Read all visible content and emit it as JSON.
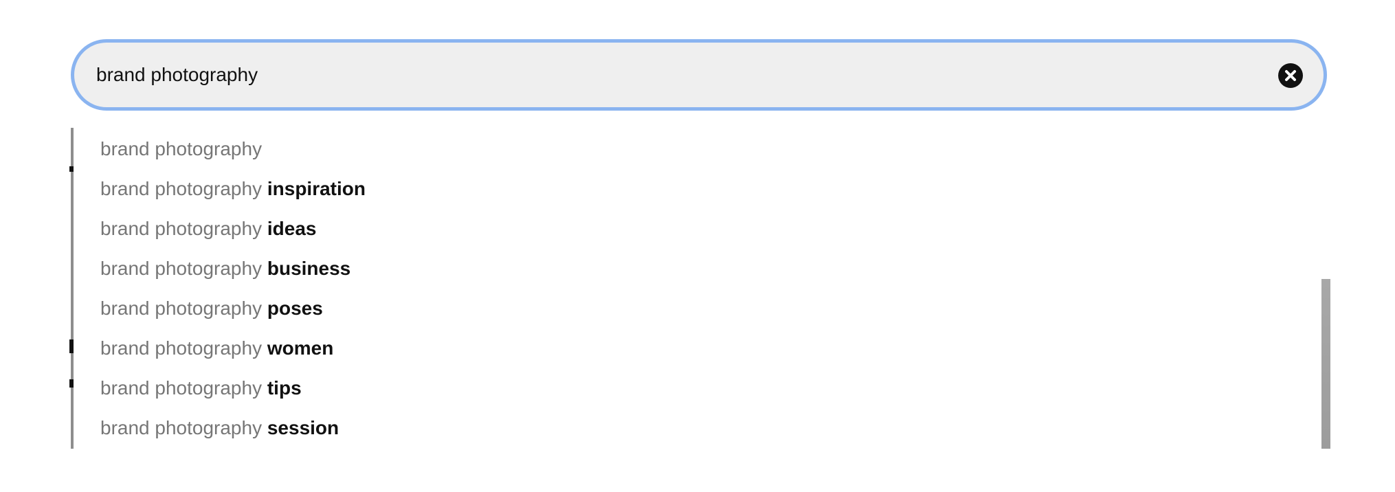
{
  "search": {
    "query": "brand photography",
    "clear_icon": "close-circle-icon",
    "focus_ring_color": "#8ab4f0",
    "field_background": "#efefef"
  },
  "suggestions": [
    {
      "base": "brand photography",
      "extra": ""
    },
    {
      "base": "brand photography",
      "extra": "inspiration"
    },
    {
      "base": "brand photography",
      "extra": "ideas"
    },
    {
      "base": "brand photography",
      "extra": "business"
    },
    {
      "base": "brand photography",
      "extra": "poses"
    },
    {
      "base": "brand photography",
      "extra": "women"
    },
    {
      "base": "brand photography",
      "extra": "tips"
    },
    {
      "base": "brand photography",
      "extra": "session"
    }
  ]
}
